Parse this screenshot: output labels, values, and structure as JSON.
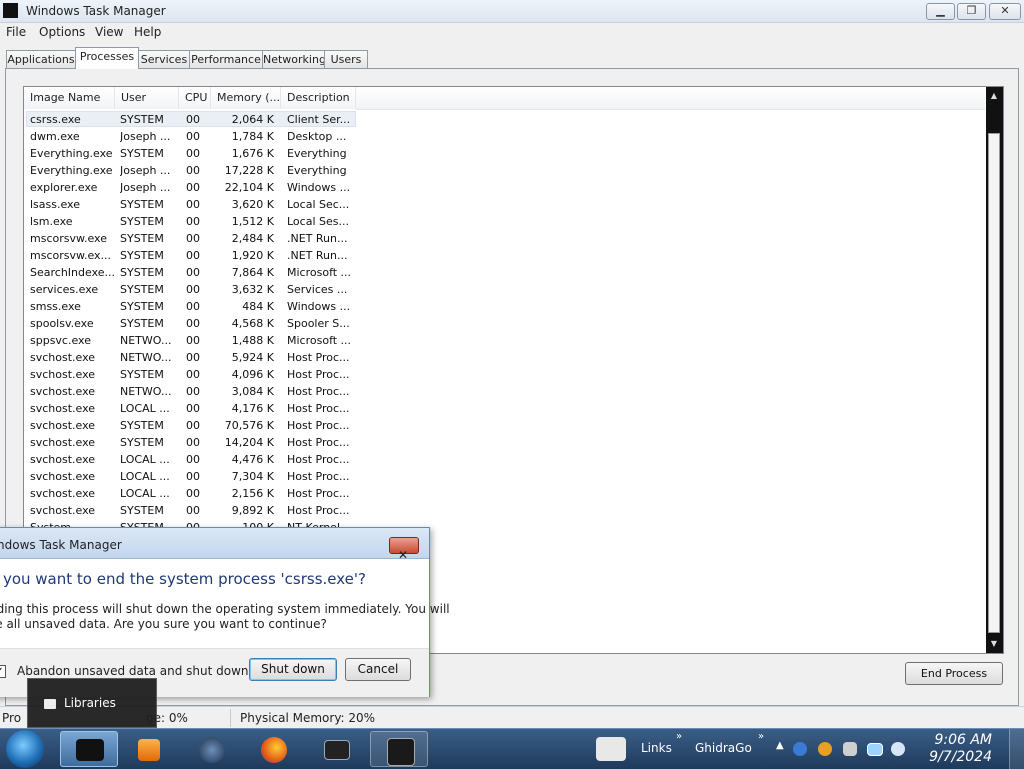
{
  "window": {
    "title": "Windows Task Manager"
  },
  "menu": [
    "File",
    "Options",
    "View",
    "Help"
  ],
  "tabs": [
    "Applications",
    "Processes",
    "Services",
    "Performance",
    "Networking",
    "Users"
  ],
  "active_tab": "Processes",
  "columns": [
    "Image Name",
    "User Name",
    "CPU",
    "Memory (...",
    "Description"
  ],
  "processes": [
    [
      "csrss.exe",
      "SYSTEM",
      "00",
      "2,064 K",
      "Client Ser..."
    ],
    [
      "dwm.exe",
      "Joseph ...",
      "00",
      "1,784 K",
      "Desktop ..."
    ],
    [
      "Everything.exe",
      "SYSTEM",
      "00",
      "1,676 K",
      "Everything"
    ],
    [
      "Everything.exe",
      "Joseph ...",
      "00",
      "17,228 K",
      "Everything"
    ],
    [
      "explorer.exe",
      "Joseph ...",
      "00",
      "22,104 K",
      "Windows ..."
    ],
    [
      "lsass.exe",
      "SYSTEM",
      "00",
      "3,620 K",
      "Local Sec..."
    ],
    [
      "lsm.exe",
      "SYSTEM",
      "00",
      "1,512 K",
      "Local Ses..."
    ],
    [
      "mscorsvw.exe",
      "SYSTEM",
      "00",
      "2,484 K",
      ".NET Run..."
    ],
    [
      "mscorsvw.ex...",
      "SYSTEM",
      "00",
      "1,920 K",
      ".NET Run..."
    ],
    [
      "SearchIndexe...",
      "SYSTEM",
      "00",
      "7,864 K",
      "Microsoft ..."
    ],
    [
      "services.exe",
      "SYSTEM",
      "00",
      "3,632 K",
      "Services ..."
    ],
    [
      "smss.exe",
      "SYSTEM",
      "00",
      "484 K",
      "Windows ..."
    ],
    [
      "spoolsv.exe",
      "SYSTEM",
      "00",
      "4,568 K",
      "Spooler S..."
    ],
    [
      "sppsvc.exe",
      "NETWO...",
      "00",
      "1,488 K",
      "Microsoft ..."
    ],
    [
      "svchost.exe",
      "NETWO...",
      "00",
      "5,924 K",
      "Host Proc..."
    ],
    [
      "svchost.exe",
      "SYSTEM",
      "00",
      "4,096 K",
      "Host Proc..."
    ],
    [
      "svchost.exe",
      "NETWO...",
      "00",
      "3,084 K",
      "Host Proc..."
    ],
    [
      "svchost.exe",
      "LOCAL ...",
      "00",
      "4,176 K",
      "Host Proc..."
    ],
    [
      "svchost.exe",
      "SYSTEM",
      "00",
      "70,576 K",
      "Host Proc..."
    ],
    [
      "svchost.exe",
      "SYSTEM",
      "00",
      "14,204 K",
      "Host Proc..."
    ],
    [
      "svchost.exe",
      "LOCAL ...",
      "00",
      "4,476 K",
      "Host Proc..."
    ],
    [
      "svchost.exe",
      "LOCAL ...",
      "00",
      "7,304 K",
      "Host Proc..."
    ],
    [
      "svchost.exe",
      "LOCAL ...",
      "00",
      "2,156 K",
      "Host Proc..."
    ],
    [
      "svchost.exe",
      "SYSTEM",
      "00",
      "9,892 K",
      "Host Proc..."
    ],
    [
      "System",
      "SYSTEM",
      "00",
      "100 K",
      "NT Kernel..."
    ]
  ],
  "end_process_label": "End Process",
  "status": {
    "processes": "Pro",
    "cpu_usage": "ge: 0%",
    "physical_memory": "Physical Memory: 20%"
  },
  "dialog": {
    "title": "ndows Task Manager",
    "heading": "o you want to end the system process 'csrss.exe'?",
    "body_line1": "nding this process will shut down the operating system immediately.  You will",
    "body_line2": "se all unsaved data.  Are you sure you want to continue?",
    "checkbox_label": "Abandon unsaved data and shut down.",
    "checkbox_checked": true,
    "shutdown_label": "Shut down",
    "cancel_label": "Cancel"
  },
  "tooltip": {
    "label": "Libraries"
  },
  "taskbar": {
    "links_label": "Links",
    "ghidra_label": "GhidraGo",
    "time": "9:06 AM",
    "date": "9/7/2024"
  }
}
